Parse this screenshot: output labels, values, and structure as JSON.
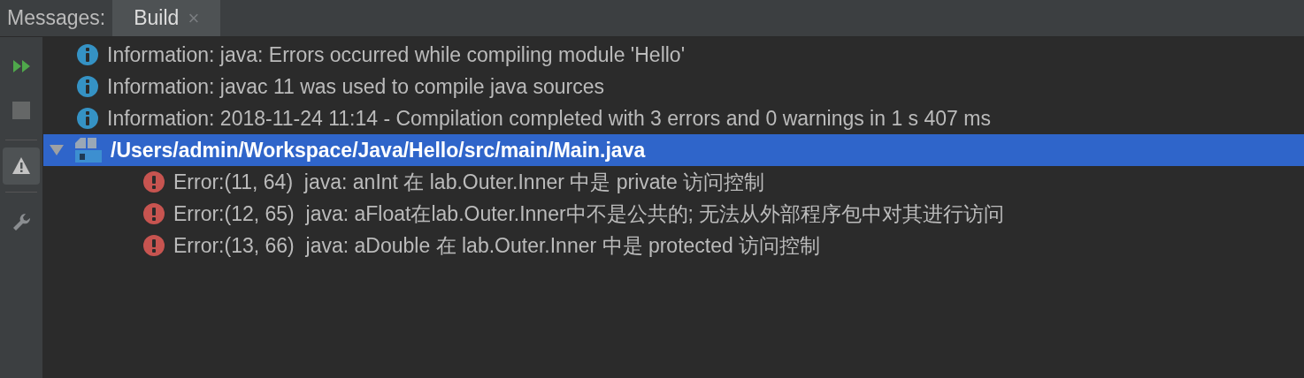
{
  "tab_bar": {
    "label": "Messages:",
    "tabs": [
      {
        "label": "Build",
        "close": "×",
        "selected": true
      }
    ]
  },
  "toolbar": [
    {
      "kind": "rerun",
      "selected": false
    },
    {
      "kind": "stop",
      "selected": false
    },
    {
      "kind": "warnings",
      "selected": true
    },
    {
      "kind": "settings",
      "selected": false
    }
  ],
  "tree": [
    {
      "kind": "info",
      "text": "Information: java: Errors occurred while compiling module 'Hello'",
      "selected": false
    },
    {
      "kind": "info",
      "text": "Information: javac 11 was used to compile java sources",
      "selected": false
    },
    {
      "kind": "info",
      "text": "Information: 2018-11-24 11:14 - Compilation completed with 3 errors and 0 warnings in 1 s 407 ms",
      "selected": false
    },
    {
      "kind": "file",
      "text": "/Users/admin/Workspace/Java/Hello/src/main/Main.java",
      "selected": true,
      "expanded": true,
      "children": [
        {
          "kind": "error",
          "text": "Error:(11, 64)  java: anInt 在 lab.Outer.Inner 中是 private 访问控制",
          "selected": false
        },
        {
          "kind": "error",
          "text": "Error:(12, 65)  java: aFloat在lab.Outer.Inner中不是公共的; 无法从外部程序包中对其进行访问",
          "selected": false
        },
        {
          "kind": "error",
          "text": "Error:(13, 66)  java: aDouble 在 lab.Outer.Inner 中是 protected 访问控制",
          "selected": false
        }
      ]
    }
  ]
}
